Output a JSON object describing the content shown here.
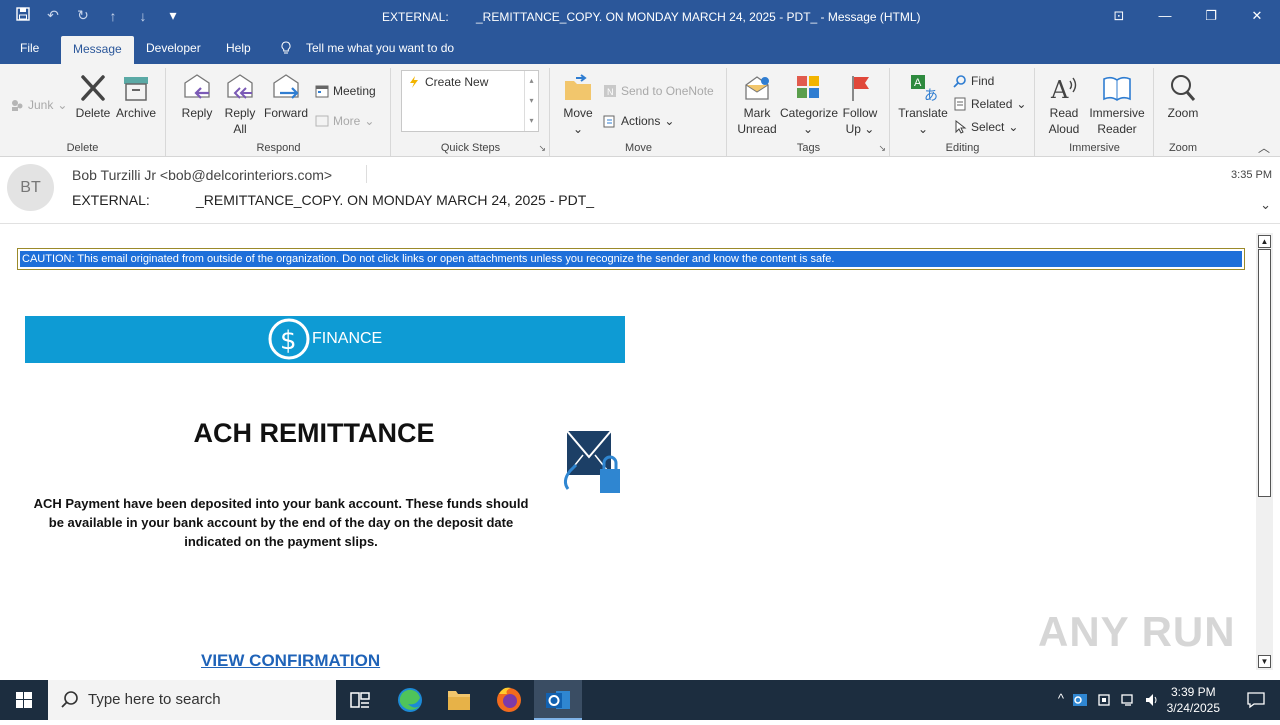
{
  "window": {
    "title_prefix": "EXTERNAL:",
    "title_subject": "_REMITTANCE_COPY. ON MONDAY MARCH 24, 2025 - PDT_  -  Message (HTML)",
    "min_glyph": "—",
    "max_glyph": "❐",
    "close_glyph": "✕",
    "ribbon_glyph": "⊡"
  },
  "tabs": [
    "File",
    "Message",
    "Developer",
    "Help"
  ],
  "tell_me": "Tell me what you want to do",
  "ribbon": {
    "junk": "Junk",
    "delete": "Delete",
    "archive": "Archive",
    "group_delete": "Delete",
    "reply": "Reply",
    "reply_all_1": "Reply",
    "reply_all_2": "All",
    "forward": "Forward",
    "meeting": "Meeting",
    "more": "More",
    "group_respond": "Respond",
    "create_new": "Create New",
    "group_quick_steps": "Quick Steps",
    "move": "Move",
    "send_onenote": "Send to OneNote",
    "actions": "Actions",
    "group_move": "Move",
    "mark_unread_1": "Mark",
    "mark_unread_2": "Unread",
    "categorize": "Categorize",
    "follow_up_1": "Follow",
    "follow_up_2": "Up",
    "group_tags": "Tags",
    "translate": "Translate",
    "find": "Find",
    "related": "Related",
    "select": "Select",
    "group_editing": "Editing",
    "read_aloud_1": "Read",
    "read_aloud_2": "Aloud",
    "immersive_1": "Immersive",
    "immersive_2": "Reader",
    "group_immersive": "Immersive",
    "zoom": "Zoom",
    "group_zoom": "Zoom"
  },
  "message": {
    "avatar_initials": "BT",
    "from": "Bob Turzilli Jr <bob@delcorinteriors.com>",
    "subject_prefix": "EXTERNAL:",
    "subject": "_REMITTANCE_COPY. ON MONDAY MARCH 24, 2025 - PDT_",
    "time": "3:35 PM"
  },
  "body": {
    "caution": "CAUTION: This email originated from outside of the organization. Do not click links or open attachments unless you recognize the sender and know the content is safe.",
    "banner": "FINANCE",
    "heading": "ACH REMITTANCE",
    "paragraph": "ACH Payment have been deposited into your bank account.  These funds should be available in your bank account by the end of the day on the deposit date indicated on the payment slips.",
    "link": "VIEW CONFIRMATION",
    "watermark": "ANY RUN"
  },
  "taskbar": {
    "search_placeholder": "Type here to search",
    "time": "3:39 PM",
    "date": "3/24/2025"
  },
  "colors": {
    "accent": "#2b579a",
    "banner": "#0e9bd4",
    "caution_bg": "#1e6fd9",
    "link": "#1f63b8",
    "taskbar": "#1c2d3f"
  }
}
